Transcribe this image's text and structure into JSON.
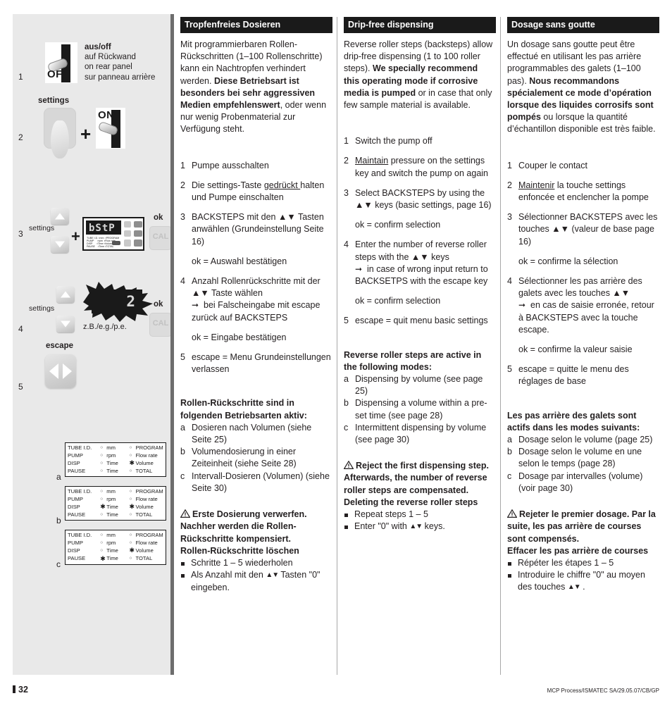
{
  "footer": {
    "page_number": "32",
    "reference": "MCP Process/ISMATEC SA/29.05.07/CB/GP"
  },
  "illustration": {
    "steps": [
      "1",
      "2",
      "3",
      "4",
      "5"
    ],
    "abc_labels": [
      "a",
      "b",
      "c"
    ],
    "step1": {
      "switch_label": "OFF",
      "caption_bold": "aus/off",
      "caption_line2": "auf Rückwand",
      "caption_line3": "on rear panel",
      "caption_line4": "sur panneau arrière"
    },
    "step2": {
      "settings_label": "settings",
      "plus": "+",
      "switch_label": "ON"
    },
    "step3": {
      "settings_label": "settings",
      "plus": "+",
      "display_text": "bStP",
      "ok_label": "ok",
      "cal_label": "CAL"
    },
    "step4": {
      "settings_label": "settings",
      "display_value": "2",
      "example_label": "z.B./e.g./p.e.",
      "ok_label": "ok",
      "cal_label": "CAL"
    },
    "step5": {
      "escape_label": "escape"
    },
    "lcd_matrix": {
      "rows": [
        "TUBE I.D.",
        "PUMP",
        "DISP",
        "PAUSE"
      ],
      "mid": [
        "mm",
        "rpm",
        "Time",
        "Time"
      ],
      "right": [
        "PROGRAM",
        "Flow rate",
        "Volume",
        "TOTAL"
      ]
    },
    "mode_tables": {
      "columns": {
        "names": [
          "TUBE I.D.",
          "PUMP",
          "DISP",
          "PAUSE"
        ],
        "mid_options": [
          "mm",
          "rpm",
          "Time",
          "Time"
        ],
        "right_options": [
          "PROGRAM",
          "Flow rate",
          "Volume",
          "TOTAL"
        ]
      },
      "a": {
        "mid_active": [
          false,
          false,
          false,
          false
        ],
        "right_active": [
          false,
          false,
          true,
          false
        ]
      },
      "b": {
        "mid_active": [
          false,
          false,
          true,
          false
        ],
        "right_active": [
          false,
          false,
          true,
          false
        ]
      },
      "c": {
        "mid_active": [
          false,
          false,
          false,
          true
        ],
        "right_active": [
          false,
          false,
          true,
          false
        ]
      }
    }
  },
  "columns": {
    "de": {
      "header": "Tropfenfreies Dosieren",
      "intro_part1": "Mit programmierbaren Rollen-Rückschritten (1–100 Rollenschritte) kann ein Nachtropfen verhindert werden. ",
      "intro_bold": "Diese Betriebsart ist besonders bei sehr aggressiven Medien empfehlenswert",
      "intro_part2": ", oder wenn nur wenig Probenmaterial zur Verfügung steht.",
      "steps": [
        {
          "idx": "1",
          "text": "Pumpe ausschalten"
        },
        {
          "idx": "2",
          "pre": "Die settings-Taste ",
          "underline": "gedrückt ",
          "post": "halten und Pumpe einschalten"
        },
        {
          "idx": "3",
          "text": "BACKSTEPS mit den ▲▼ Tasten anwählen (Grundeinstellung Seite 16)",
          "note": "ok = Auswahl bestätigen"
        },
        {
          "idx": "4",
          "text": "Anzahl Rollenrückschritte mit der ▲▼ Taste wählen",
          "arrow_text": "bei Falscheingabe mit escape zurück auf BACKSTEPS",
          "note": "ok = Eingabe bestätigen"
        },
        {
          "idx": "5",
          "text": "escape = Menu Grundeinstellungen verlassen"
        }
      ],
      "modes_head": "Rollen-Rückschritte sind in folgenden Betriebsarten aktiv:",
      "modes": [
        {
          "idx": "a",
          "text": "Dosieren nach Volumen (siehe Seite 25)"
        },
        {
          "idx": "b",
          "text": "Volumendosierung in einer Zeiteinheit (siehe Seite 28)"
        },
        {
          "idx": "c",
          "text": "Intervall-Dosieren (Volumen) (siehe Seite 30)"
        }
      ],
      "warning": "Erste Dosierung verwerfen. Nachher werden die Rollen-Rückschritte kompensiert.",
      "delete_head": "Rollen-Rückschritte löschen",
      "bullets": [
        {
          "text": "Schritte 1 – 5 wiederholen"
        },
        {
          "pre": "Als Anzahl mit den ",
          "keys": "▲▼",
          "post": " Tasten \"0\" eingeben."
        }
      ]
    },
    "en": {
      "header": "Drip-free dispensing",
      "intro_part1": "Reverse roller steps (backsteps) allow drip-free dispensing (1 to 100 roller steps). ",
      "intro_bold": "We specially recommend this operating mode if corrosive media is pumped",
      "intro_part2": " or in case that only few sample material is available.",
      "steps": [
        {
          "idx": "1",
          "text": "Switch the pump off"
        },
        {
          "idx": "2",
          "pre": "",
          "underline": "Maintain",
          "post": " pressure on the settings key and switch the pump on again"
        },
        {
          "idx": "3",
          "text": "Select BACKSTEPS by using the ▲▼ keys (basic settings, page 16)",
          "note": "ok = confirm selection"
        },
        {
          "idx": "4",
          "text": "Enter the number of reverse roller steps with the ▲▼ keys",
          "arrow_text": "in case of wrong input return to BACKSETPS with the escape key",
          "note": "ok = confirm selection"
        },
        {
          "idx": "5",
          "text": "escape = quit menu basic settings"
        }
      ],
      "modes_head": "Reverse roller steps are active in the following modes:",
      "modes": [
        {
          "idx": "a",
          "text": "Dispensing by volume (see page 25)"
        },
        {
          "idx": "b",
          "text": "Dispensing a volume within a pre-set time (see page 28)"
        },
        {
          "idx": "c",
          "text": "Intermittent dispensing by volume (see page 30)"
        }
      ],
      "warning": "Reject the first dispensing step. Afterwards, the number of reverse roller steps are compensated.",
      "delete_head": "Deleting the reverse roller steps",
      "bullets": [
        {
          "text": "Repeat steps 1 – 5"
        },
        {
          "pre": "Enter \"0\" with ",
          "keys": "▲▼",
          "post": " keys."
        }
      ]
    },
    "fr": {
      "header": "Dosage sans goutte",
      "intro_part1": "Un dosage sans goutte peut être effectué en utilisant les pas arrière programmables des galets (1–100 pas). ",
      "intro_bold": "Nous recommandons spécialement ce mode d’opération lorsque des liquides corrosifs sont pompés",
      "intro_part2": " ou lorsque la quantité d’échantillon disponible est très faible.",
      "steps": [
        {
          "idx": "1",
          "text": "Couper le contact"
        },
        {
          "idx": "2",
          "pre": "",
          "underline": "Maintenir",
          "post": " la touche settings enfoncée et enclencher la pompe"
        },
        {
          "idx": "3",
          "text": "Sélectionner BACKSTEPS avec les touches ▲▼ (valeur de base page 16)",
          "note": "ok = confirme la sélection"
        },
        {
          "idx": "4",
          "text": "Sélectionner les pas arrière des galets avec les touches ▲▼",
          "arrow_text": "en cas de saisie erronée, retour à BACKSTEPS avec la touche escape.",
          "note": "ok = confirme la valeur saisie"
        },
        {
          "idx": "5",
          "text": "escape = quitte le menu des réglages de base"
        }
      ],
      "modes_head": "Les pas arrière des galets sont actifs dans les modes suivants:",
      "modes": [
        {
          "idx": "a",
          "text": "Dosage selon le volume (page 25)"
        },
        {
          "idx": "b",
          "text": "Dosage selon le volume en une selon le temps (page 28)"
        },
        {
          "idx": "c",
          "text": "Dosage par intervalles (volume) (voir page 30)"
        }
      ],
      "warning": "Rejeter le premier dosage. Par la suite, les pas arrière de courses sont compensés.",
      "delete_head": "Effacer les pas arrière de courses",
      "bullets": [
        {
          "text": "Répéter les étapes 1 – 5"
        },
        {
          "pre": "Introduire le chiffre \"0\" au moyen des touches ",
          "keys": "▲▼",
          "post": " ."
        }
      ]
    }
  },
  "colors": {
    "header_bg": "#1a1a1a",
    "panel_bg": "#e9e9e9",
    "text": "#231f20"
  }
}
